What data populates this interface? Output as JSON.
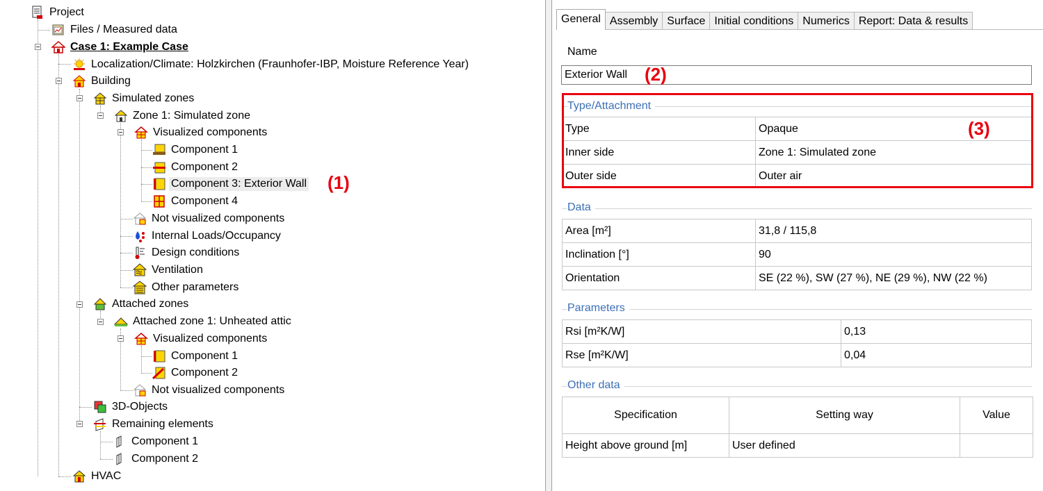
{
  "tree": {
    "project": "Project",
    "files": "Files / Measured data",
    "case": "Case 1: Example Case",
    "climate": "Localization/Climate: Holzkirchen (Fraunhofer-IBP, Moisture Reference Year)",
    "building": "Building",
    "simulated_zones": "Simulated zones",
    "zone1": "Zone 1: Simulated zone",
    "visualized_components": "Visualized components",
    "zone1_components": [
      "Component 1",
      "Component 2",
      "Component 3: Exterior Wall",
      "Component 4"
    ],
    "not_visualized_components": "Not visualized components",
    "internal_loads": "Internal Loads/Occupancy",
    "design_conditions": "Design conditions",
    "ventilation": "Ventilation",
    "other_parameters": "Other parameters",
    "attached_zones": "Attached zones",
    "attached_zone1": "Attached zone 1: Unheated attic",
    "attached_visualized_components": "Visualized components",
    "attached_components": [
      "Component 1",
      "Component 2"
    ],
    "attached_not_visualized_components": "Not visualized components",
    "objects_3d": "3D-Objects",
    "remaining_elements": "Remaining elements",
    "remaining_components": [
      "Component 1",
      "Component 2"
    ],
    "hvac": "HVAC"
  },
  "annotations": [
    "(1)",
    "(2)",
    "(3)"
  ],
  "tabs": [
    "General",
    "Assembly",
    "Surface",
    "Initial conditions",
    "Numerics",
    "Report: Data & results"
  ],
  "active_tab": "General",
  "name_field": {
    "label": "Name",
    "value": "Exterior Wall"
  },
  "type_attachment": {
    "title": "Type/Attachment",
    "rows": [
      [
        "Type",
        "Opaque"
      ],
      [
        "Inner side",
        "Zone 1: Simulated zone"
      ],
      [
        "Outer side",
        "Outer air"
      ]
    ]
  },
  "data_group": {
    "title": "Data",
    "rows": [
      [
        "Area  [m²]",
        "31,8 / 115,8"
      ],
      [
        "Inclination  [°]",
        "90"
      ],
      [
        "Orientation",
        "SE (22 %), SW (27 %), NE (29 %), NW (22 %)"
      ]
    ]
  },
  "parameters": {
    "title": "Parameters",
    "rows": [
      [
        "Rsi  [m²K/W]",
        "0,13"
      ],
      [
        "Rse  [m²K/W]",
        "0,04"
      ]
    ]
  },
  "other_data": {
    "title": "Other data",
    "headers": [
      "Specification",
      "Setting way",
      "Value"
    ],
    "rows": [
      [
        "Height above ground  [m]",
        "User defined",
        ""
      ]
    ]
  },
  "colors": {
    "annotation": "#e8000f",
    "group_title": "#3c6fb5"
  }
}
